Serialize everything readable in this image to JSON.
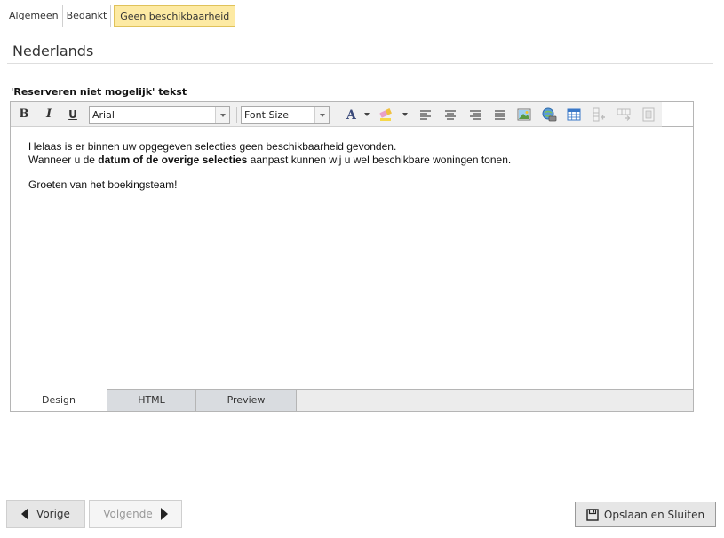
{
  "tabs": [
    {
      "label": "Algemeen"
    },
    {
      "label": "Bedankt"
    },
    {
      "label": "Geen beschikbaarheid"
    }
  ],
  "active_tab": "Geen beschikbaarheid",
  "section_title": "Nederlands",
  "field_label": "'Reserveren niet mogelijk' tekst",
  "toolbar": {
    "bold": "B",
    "italic": "I",
    "underline": "U",
    "font_family": "Arial",
    "font_size": "Font Size",
    "font_color_letter": "A",
    "icons": [
      "bold-icon",
      "italic-icon",
      "underline-icon",
      "font-color-icon",
      "highlight-icon",
      "align-left-icon",
      "align-center-icon",
      "align-right-icon",
      "justify-icon",
      "image-icon",
      "link-icon",
      "table-icon",
      "insert-column-icon",
      "insert-row-icon",
      "cell-icon"
    ]
  },
  "content": {
    "line1": "Helaas is er binnen uw opgegeven selecties geen beschikbaarheid gevonden.",
    "line2_pre": "Wanneer u de ",
    "line2_bold": "datum of de overige selecties",
    "line2_post": " aanpast kunnen wij u wel beschikbare woningen tonen.",
    "line3": "Groeten van het boekingsteam!"
  },
  "modes": [
    {
      "label": "Design"
    },
    {
      "label": "HTML"
    },
    {
      "label": "Preview"
    }
  ],
  "active_mode": "Design",
  "buttons": {
    "prev": "Vorige",
    "next": "Volgende",
    "save": "Opslaan en Sluiten"
  },
  "colors": {
    "active_tab_bg": "#fdeaa3",
    "active_tab_border": "#e0c25a",
    "toolbar_bg": "#f0f0f0",
    "mode_tab_bg": "#d9dce0"
  }
}
